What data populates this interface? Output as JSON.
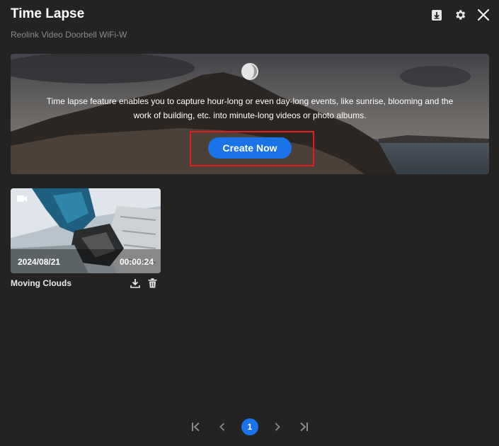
{
  "header": {
    "title": "Time Lapse",
    "subtitle": "Reolink Video Doorbell WiFi-W",
    "icons": [
      "download-list-icon",
      "gear-icon",
      "close-icon"
    ]
  },
  "banner": {
    "line1": "Time lapse feature enables you to capture hour-long or even day-long events, like sunrise, blooming and the",
    "line2": "work of building, etc. into minute-long videos or photo albums.",
    "create_label": "Create Now"
  },
  "videos": [
    {
      "date": "2024/08/21",
      "duration": "00:00:24",
      "name": "Moving Clouds"
    }
  ],
  "pagination": {
    "current": "1"
  },
  "colors": {
    "background": "#232323",
    "accent": "#1a73e8",
    "highlight": "#e02020",
    "subtitle": "#8a8a8a"
  }
}
